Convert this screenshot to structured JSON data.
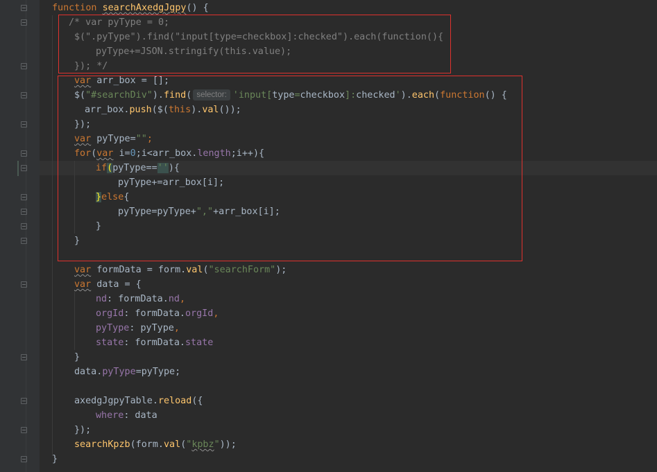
{
  "editor": {
    "accent_color": "#e0322e",
    "lines": {
      "l1": {
        "kw": "function",
        "sp": " ",
        "name": "searchAxedgJgpy",
        "rest": "() {"
      },
      "l2": {
        "text": "/* var pyType = 0;"
      },
      "l3": {
        "text": "$(\".pyType\").find(\"input[type=checkbox]:checked\").each(function(){"
      },
      "l4": {
        "text": "pyType+=JSON.stringify(this.value);"
      },
      "l5": {
        "text": "}); */"
      },
      "l6": {
        "kw": "var",
        "rest": " arr_box = [];"
      },
      "l7": {
        "a": "$(",
        "b": "\"#searchDiv\"",
        "c": ").",
        "d": "find",
        "e": "(",
        "hint": "selector:",
        "f": "'input[",
        "g": "type",
        "h": "=",
        "i": "checkbox",
        "j": "]:",
        "k": "checked",
        "l": "'",
        "m": ").",
        "n": "each",
        "o": "(",
        "p": "function",
        "q": "() {"
      },
      "l8": {
        "a": "arr_box.",
        "b": "push",
        "c": "($(",
        "d": "this",
        "e": ").",
        "f": "val",
        "g": "());"
      },
      "l9": {
        "text": "});"
      },
      "l10": {
        "kw": "var",
        "a": " pyType=",
        "str": "\"\"",
        "semi": ";"
      },
      "l11": {
        "a": "for",
        "b": "(",
        "kw": "var",
        "c": " i=",
        "num": "0",
        "d": ";i<arr_box.",
        "prop": "length",
        "e": ";i++){"
      },
      "l12": {
        "a": "if",
        "b": "(",
        "c": "pyType==",
        "str": "''",
        "d": "){"
      },
      "l13": {
        "text": "pyType+=arr_box[i];"
      },
      "l14": {
        "a": "}",
        "b": "else",
        "c": "{"
      },
      "l15": {
        "a": "pyType=pyType+",
        "str": "\",\"",
        "b": "+arr_box[i];"
      },
      "l16": {
        "text": "}"
      },
      "l17": {
        "text": "}"
      },
      "l18": {
        "kw": "var",
        "a": " formData = form.",
        "fn": "val",
        "b": "(",
        "str": "\"searchForm\"",
        "c": ");"
      },
      "l19": {
        "kw": "var",
        "a": " data = {"
      },
      "l20": {
        "prop": "nd",
        "a": ": formData.",
        "prop2": "nd",
        "comma": ","
      },
      "l21": {
        "prop": "orgId",
        "a": ": formData.",
        "prop2": "orgId",
        "comma": ","
      },
      "l22": {
        "prop": "pyType",
        "a": ": pyType",
        "comma": ","
      },
      "l23": {
        "prop": "state",
        "a": ": formData.",
        "prop2": "state"
      },
      "l24": {
        "text": "}"
      },
      "l25": {
        "a": "data.",
        "prop": "pyType",
        "b": "=pyType;"
      },
      "l27": {
        "a": "axedgJgpyTable.",
        "fn": "reload",
        "b": "({"
      },
      "l28": {
        "prop": "where",
        "a": ": data"
      },
      "l29": {
        "text": "});"
      },
      "l30": {
        "fn": "searchKpzb",
        "a": "(form.",
        "fn2": "val",
        "b": "(",
        "q1": "\"",
        "str": "kpbz",
        "q2": "\"",
        "c": "));"
      },
      "l31": {
        "text": "}"
      }
    }
  }
}
